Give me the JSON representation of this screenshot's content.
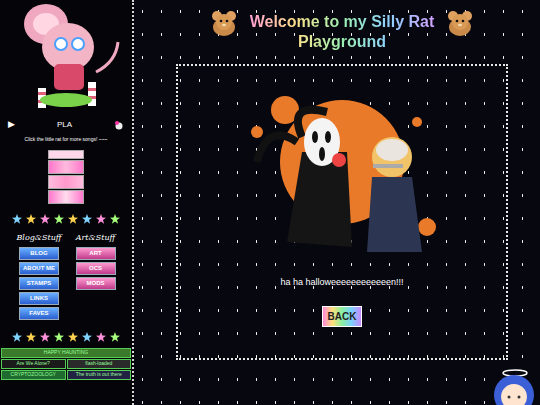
{
  "page": {
    "title": "Welcome to my Silly Rat Playground"
  },
  "player": {
    "play": "▶",
    "track": "PLA",
    "hint": "Click the little rat for more songs! ~~~"
  },
  "nav": {
    "columns": [
      {
        "heading": "Blog&Stuff",
        "items": [
          "BLOG",
          "ABOUT ME",
          "STAMPS",
          "LINKS",
          "FAVES"
        ]
      },
      {
        "heading": "Art&Stuff",
        "items": [
          "ART",
          "OCS",
          "MODS"
        ]
      }
    ]
  },
  "blinkies": [
    {
      "text": "HAPPY HAUNTING",
      "color": "#3a7a2a"
    },
    {
      "text": "Are We Alone?",
      "color": "#1a1a1a"
    },
    {
      "text": "flash-loaded",
      "color": "#2a2a2a"
    },
    {
      "text": "CRYPTOZOOLOGY",
      "color": "#1f6b2f"
    },
    {
      "text": "The truth is out there",
      "color": "#222244"
    }
  ],
  "content": {
    "caption": "ha ha halloweeeeeeeeeeeen!!!",
    "button": "BACK"
  }
}
